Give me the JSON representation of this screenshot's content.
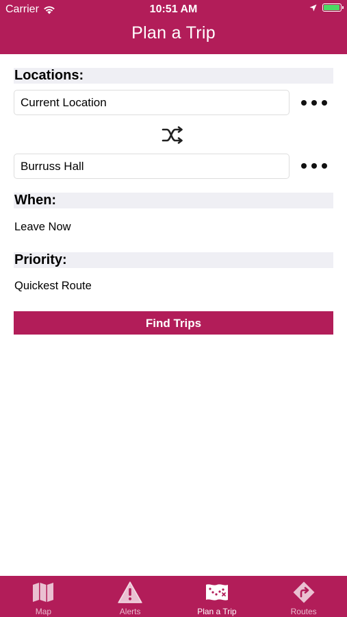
{
  "status_bar": {
    "carrier": "Carrier",
    "time": "10:51 AM",
    "battery_level": 1.0,
    "battery_color": "#4cd964"
  },
  "header": {
    "title": "Plan a Trip",
    "background_color": "#b21d59"
  },
  "locations": {
    "section_title": "Locations:",
    "origin_value": "Current Location",
    "destination_value": "Burruss Hall",
    "more_icon": "ellipsis-icon",
    "swap_icon": "shuffle-icon"
  },
  "when": {
    "section_title": "When:",
    "value": "Leave Now"
  },
  "priority": {
    "section_title": "Priority:",
    "value": "Quickest Route"
  },
  "find_button": {
    "label": "Find Trips"
  },
  "tab_bar": {
    "tabs": [
      {
        "label": "Map",
        "icon": "map-icon",
        "active": false
      },
      {
        "label": "Alerts",
        "icon": "alert-triangle-icon",
        "active": false
      },
      {
        "label": "Plan a Trip",
        "icon": "trip-map-icon",
        "active": true
      },
      {
        "label": "Routes",
        "icon": "route-sign-icon",
        "active": false
      }
    ]
  }
}
